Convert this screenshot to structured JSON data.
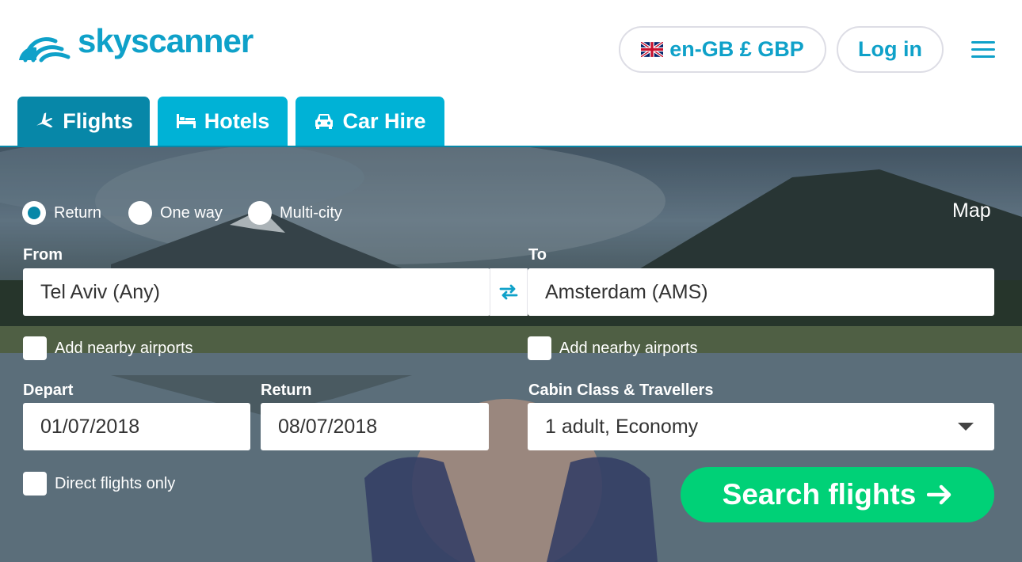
{
  "header": {
    "logo_text": "skyscanner",
    "locale_label": "en-GB £ GBP",
    "login_label": "Log in"
  },
  "tabs": [
    {
      "label": "Flights",
      "icon": "plane-icon",
      "active": true
    },
    {
      "label": "Hotels",
      "icon": "bed-icon",
      "active": false
    },
    {
      "label": "Car Hire",
      "icon": "car-icon",
      "active": false
    }
  ],
  "search_form": {
    "trip_types": [
      {
        "label": "Return",
        "checked": true
      },
      {
        "label": "One way",
        "checked": false
      },
      {
        "label": "Multi-city",
        "checked": false
      }
    ],
    "map_label": "Map",
    "from_label": "From",
    "from_value": "Tel Aviv (Any)",
    "to_label": "To",
    "to_value": "Amsterdam (AMS)",
    "nearby_from_label": "Add nearby airports",
    "nearby_to_label": "Add nearby airports",
    "depart_label": "Depart",
    "depart_value": "01/07/2018",
    "return_label": "Return",
    "return_value": "08/07/2018",
    "cabin_label": "Cabin Class & Travellers",
    "cabin_value": "1 adult, Economy",
    "direct_label": "Direct flights only",
    "search_button_label": "Search flights"
  },
  "colors": {
    "brand": "#0fa1c9",
    "tab": "#00b2d6",
    "tab_active": "#0787a8",
    "cta": "#00d177"
  }
}
